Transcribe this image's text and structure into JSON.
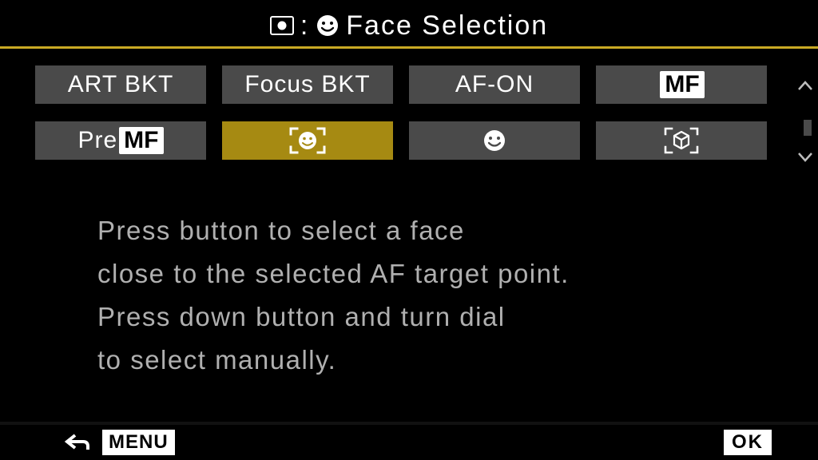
{
  "header": {
    "title": "Face Selection",
    "separator": ":"
  },
  "options": {
    "row1": [
      {
        "key": "art_bkt",
        "label": "ART BKT",
        "type": "text"
      },
      {
        "key": "focus_bkt",
        "label": "Focus BKT",
        "type": "text"
      },
      {
        "key": "af_on",
        "label": "AF-ON",
        "type": "text"
      },
      {
        "key": "mf",
        "label": "MF",
        "type": "mf-badge"
      }
    ],
    "row2": [
      {
        "key": "pre_mf",
        "type": "pre-mf",
        "pre": "Pre",
        "badge": "MF"
      },
      {
        "key": "face_sel",
        "type": "icon-face-bracket",
        "selected": true
      },
      {
        "key": "face",
        "type": "icon-face"
      },
      {
        "key": "subject",
        "type": "icon-cube-bracket"
      }
    ]
  },
  "description": {
    "line1": "Press button to select a face",
    "line2": "close to the selected AF target point.",
    "line3": "Press down button and turn dial",
    "line4": "to select manually."
  },
  "footer": {
    "menu": "MENU",
    "ok": "OK"
  },
  "colors": {
    "accent": "#c9a924",
    "selected": "#a68a12",
    "option_bg": "#4a4a4a"
  }
}
